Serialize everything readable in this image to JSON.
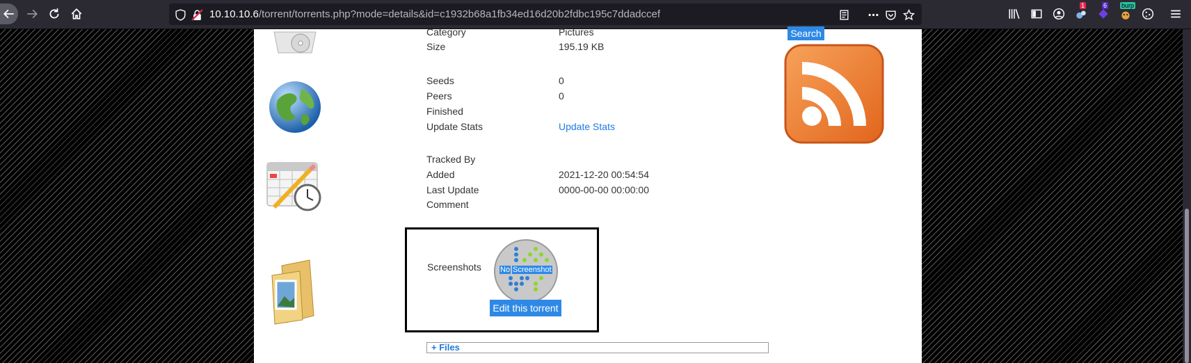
{
  "browser": {
    "url_host": "10.10.10.6",
    "url_path": "/torrent/torrents.php?mode=details&id=c1932b68a1fb34ed16d20b2fdbc195c7ddadccef",
    "extensions": [
      {
        "name": "badge-1",
        "badge": "1",
        "badge_color": "#e22850"
      },
      {
        "name": "badge-6",
        "badge": "6",
        "badge_color": "#592acb"
      },
      {
        "name": "burp",
        "badge": "burp",
        "badge_color": "#2ac3a2"
      }
    ]
  },
  "details": {
    "category_label": "Category",
    "category_value": "Pictures",
    "size_label": "Size",
    "size_value": "195.19 KB",
    "seeds_label": "Seeds",
    "seeds_value": "0",
    "peers_label": "Peers",
    "peers_value": "0",
    "finished_label": "Finished",
    "update_stats_label": "Update Stats",
    "update_stats_link": "Update Stats",
    "tracked_by_label": "Tracked By",
    "added_label": "Added",
    "added_value": "2021-12-20 00:54:54",
    "last_update_label": "Last Update",
    "last_update_value": "0000-00-00 00:00:00",
    "comment_label": "Comment"
  },
  "screenshots": {
    "label": "Screenshots",
    "no_screenshot_word1": "No",
    "no_screenshot_word2": "Screenshot",
    "edit_button": "Edit this torrent"
  },
  "files_toggle": "+ Files",
  "sidebar": {
    "search_button": "Search"
  },
  "colors": {
    "link": "#1e7be0",
    "button_blue": "#2e89e6",
    "rss_orange": "#ee7a2a"
  }
}
